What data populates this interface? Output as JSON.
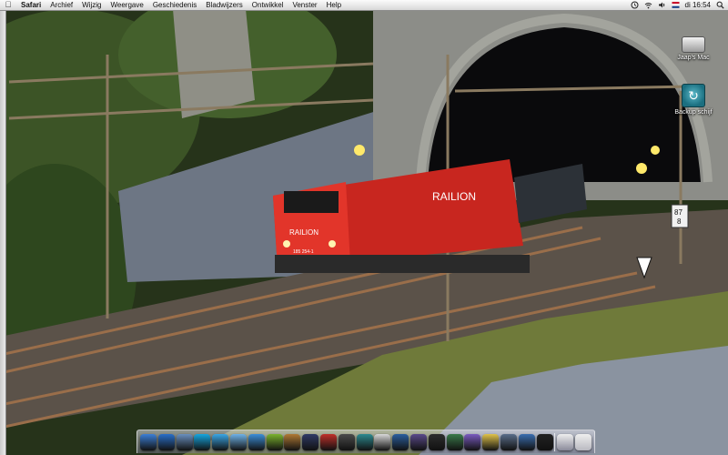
{
  "menubar": {
    "apple_icon": "apple-logo-icon",
    "app_name": "Safari",
    "items": [
      "Archief",
      "Wijzig",
      "Weergave",
      "Geschiedenis",
      "Bladwijzers",
      "Ontwikkel",
      "Venster",
      "Help"
    ],
    "status_icons": [
      "timemachine-icon",
      "wifi-icon",
      "volume-icon",
      "flag-icon"
    ],
    "clock": "di 16:54",
    "search_icon": "spotlight-icon"
  },
  "desktop": {
    "icons": [
      {
        "name": "hard-drive-icon",
        "label": "Jaap's Mac"
      },
      {
        "name": "time-machine-icon",
        "label": "Backup schijf"
      }
    ]
  },
  "wallpaper": {
    "locomotive_text": "RAILION",
    "locomotive_number": "185 254-1",
    "signal_text": "87\n8"
  },
  "dock": {
    "apps": [
      {
        "name": "finder-icon",
        "color": "#3c7fd6"
      },
      {
        "name": "safari-icon",
        "color": "#2a6fc9"
      },
      {
        "name": "preview-icon",
        "color": "#6a8fbf"
      },
      {
        "name": "skype-icon",
        "color": "#16a6e0"
      },
      {
        "name": "messenger-icon",
        "color": "#3aa6e6"
      },
      {
        "name": "ichat-icon",
        "color": "#6fb2e8"
      },
      {
        "name": "itunes-icon",
        "color": "#3b8ed8"
      },
      {
        "name": "spotify-icon",
        "color": "#7bb32e"
      },
      {
        "name": "iphoto-icon",
        "color": "#b07a35"
      },
      {
        "name": "quicktime-icon",
        "color": "#2f3a66"
      },
      {
        "name": "pdf-icon",
        "color": "#c0302a"
      },
      {
        "name": "dashboard-icon",
        "color": "#4b4b4b"
      },
      {
        "name": "time-machine-dock-icon",
        "color": "#2d8a8f"
      },
      {
        "name": "textedit-icon",
        "color": "#d8d8d8"
      },
      {
        "name": "google-earth-icon",
        "color": "#2b5f9e"
      },
      {
        "name": "photo-viewer-icon",
        "color": "#5a4a8a"
      },
      {
        "name": "terminal-icon",
        "color": "#2d2d2d"
      },
      {
        "name": "maps-icon",
        "color": "#3a7a4a"
      },
      {
        "name": "system-icon",
        "color": "#7a5bc0"
      },
      {
        "name": "notes-icon",
        "color": "#e0c34a"
      },
      {
        "name": "utility-icon",
        "color": "#5a6e8a"
      },
      {
        "name": "network-icon",
        "color": "#3a6eb0"
      },
      {
        "name": "activity-monitor-icon",
        "color": "#222222"
      }
    ],
    "stacks": [
      {
        "name": "documents-stack-icon",
        "color": "#8a8a9a"
      },
      {
        "name": "trash-icon",
        "color": "#b8b8c0"
      }
    ]
  }
}
